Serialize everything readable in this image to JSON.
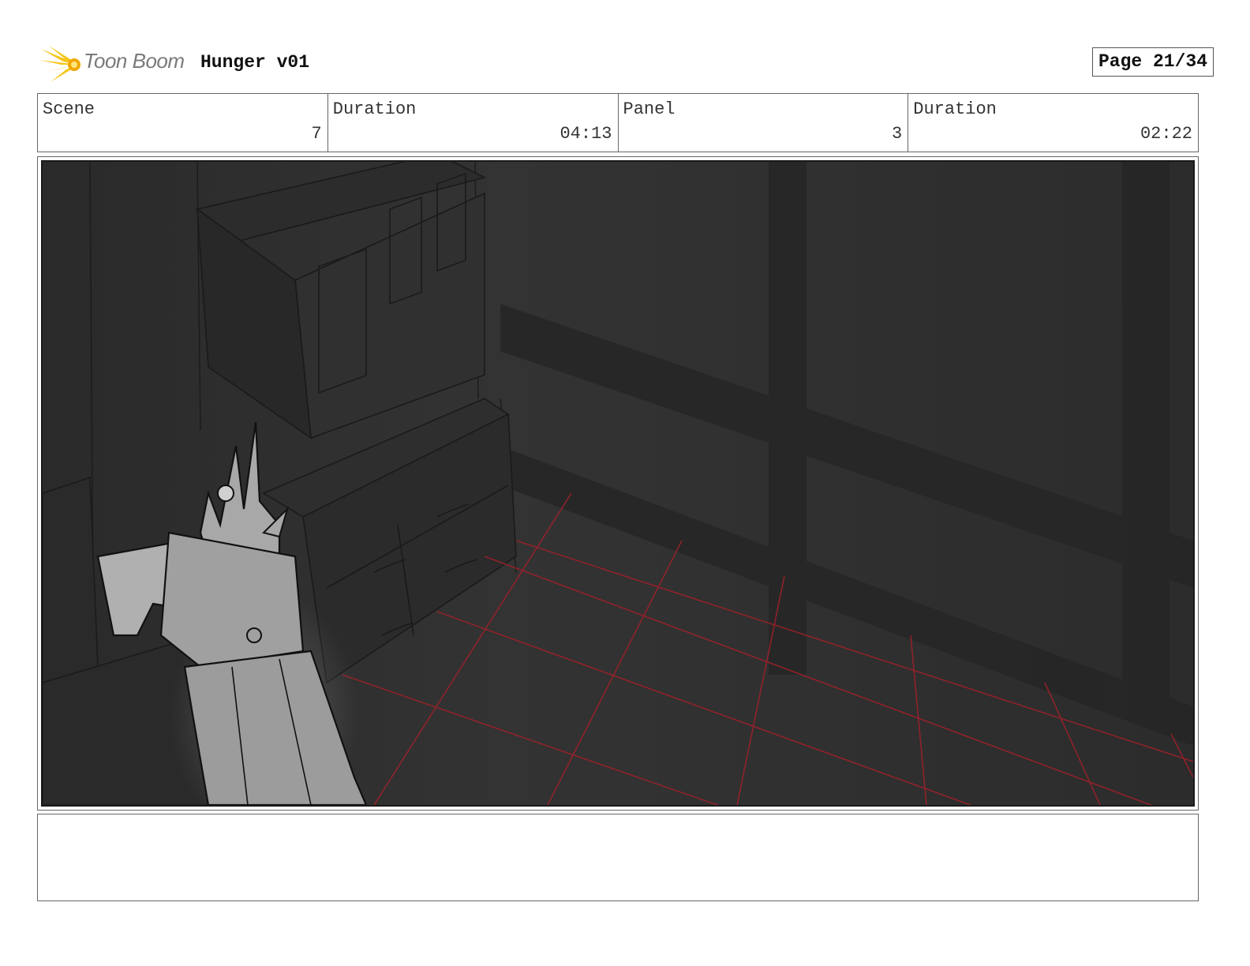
{
  "header": {
    "logo_text": "Toon Boom",
    "project_title": "Hunger v01",
    "page_label": "Page 21/34"
  },
  "info": [
    {
      "label": "Scene",
      "value": "7"
    },
    {
      "label": "Duration",
      "value": "04:13"
    },
    {
      "label": "Panel",
      "value": "3"
    },
    {
      "label": "Duration",
      "value": "02:22"
    }
  ],
  "colors": {
    "logo_star": "#f5c518",
    "panel_background": "#2f2f2f",
    "grid_lines": "#a0202a",
    "character_fill": "#a8a8a8"
  },
  "notes": ""
}
